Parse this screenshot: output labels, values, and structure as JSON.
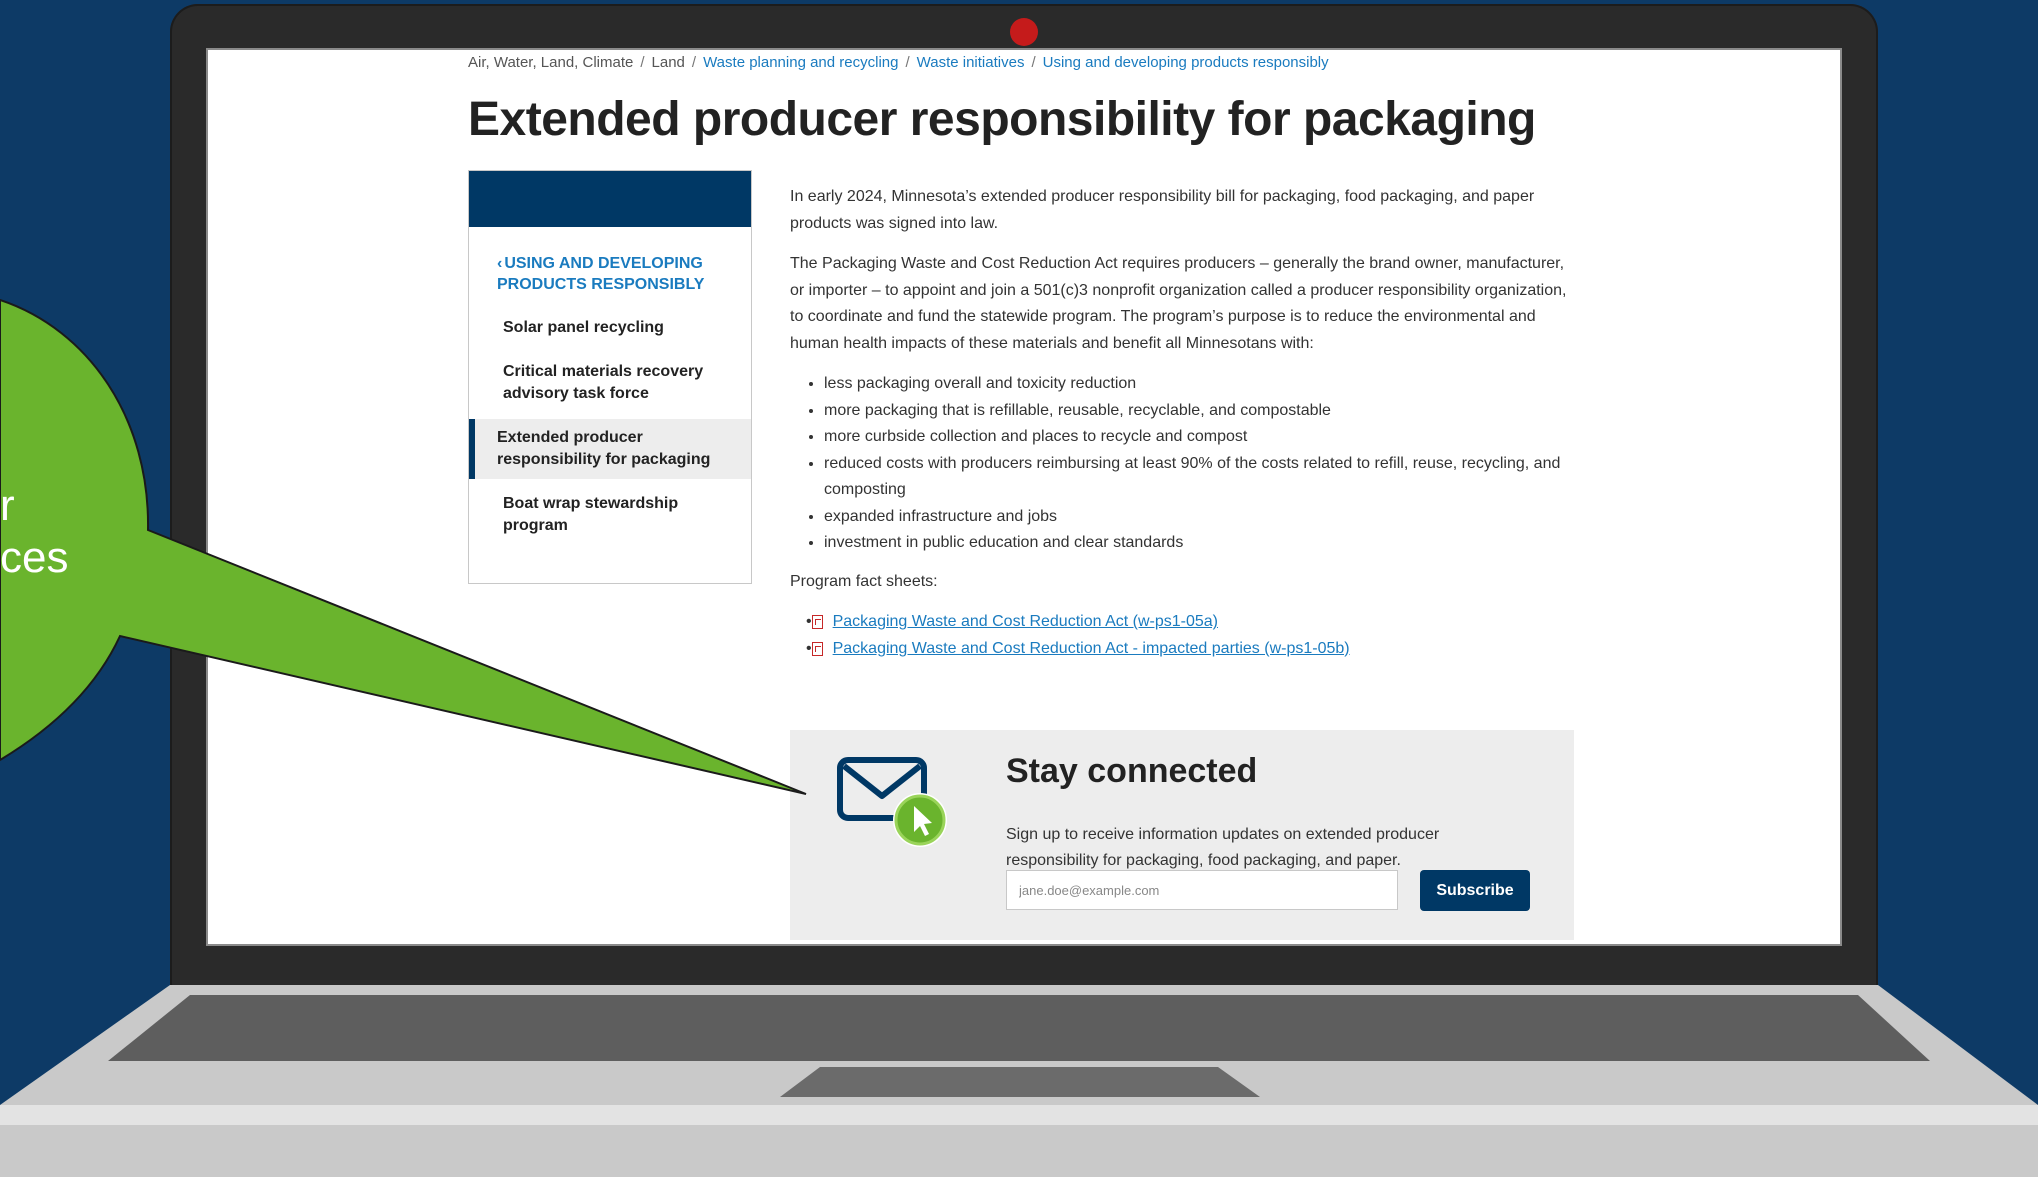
{
  "breadcrumb": {
    "items": [
      {
        "label": "Air, Water, Land, Climate",
        "link": false
      },
      {
        "label": "Land",
        "link": false
      },
      {
        "label": "Waste planning and recycling",
        "link": true
      },
      {
        "label": "Waste initiatives",
        "link": true
      },
      {
        "label": "Using and developing products responsibly",
        "link": true
      }
    ],
    "separator": "/"
  },
  "page": {
    "title": "Extended producer responsibility for packaging"
  },
  "sidenav": {
    "back_label": "Using and developing products responsibly",
    "back_icon": "chevron-left-icon",
    "items": [
      {
        "label": "Solar panel recycling",
        "active": false
      },
      {
        "label": "Critical materials recovery advisory task force",
        "active": false
      },
      {
        "label": "Extended producer responsibility for packaging",
        "active": true
      },
      {
        "label": "Boat wrap stewardship program",
        "active": false
      }
    ]
  },
  "content": {
    "intro": "In early 2024, Minnesota’s extended producer responsibility bill for packaging, food packaging, and paper products was signed into law.",
    "paragraph2": "The Packaging Waste and Cost Reduction Act requires producers – generally the brand owner, manufacturer, or importer – to appoint and join a 501(c)3 nonprofit organization called a producer responsibility organization, to coordinate and fund the statewide program. The program’s purpose is to reduce the environmental and human health impacts of these materials and benefit all Minnesotans with:",
    "benefits": [
      "less packaging overall and toxicity reduction",
      "more packaging that is refillable, reusable, recyclable, and compostable",
      "more curbside collection and places to recycle and compost",
      "reduced costs with producers reimbursing at least 90% of the costs related to refill, reuse, recycling, and composting",
      "expanded infrastructure and jobs",
      "investment in public education and clear standards"
    ],
    "fact_sheets_label": "Program fact sheets:",
    "fact_sheets": [
      {
        "label": "Packaging Waste and Cost Reduction Act (w-ps1-05a)",
        "icon": "pdf-icon"
      },
      {
        "label": "Packaging Waste and Cost Reduction Act - impacted parties (w-ps1-05b)",
        "icon": "pdf-icon"
      }
    ]
  },
  "stay_connected": {
    "icon": "envelope-click-icon",
    "title": "Stay connected",
    "description": "Sign up to receive information updates on extended producer responsibility for packaging, food packaging, and paper.",
    "email_placeholder": "jane.doe@example.com",
    "email_value": "",
    "subscribe_label": "Subscribe"
  },
  "callout": {
    "line1": "r",
    "line2": "ces"
  },
  "colors": {
    "background": "#0d3a66",
    "brand_navy": "#003865",
    "link_blue": "#1a7bbf",
    "callout_green": "#6ab42d",
    "camera_red": "#c51b1b"
  }
}
